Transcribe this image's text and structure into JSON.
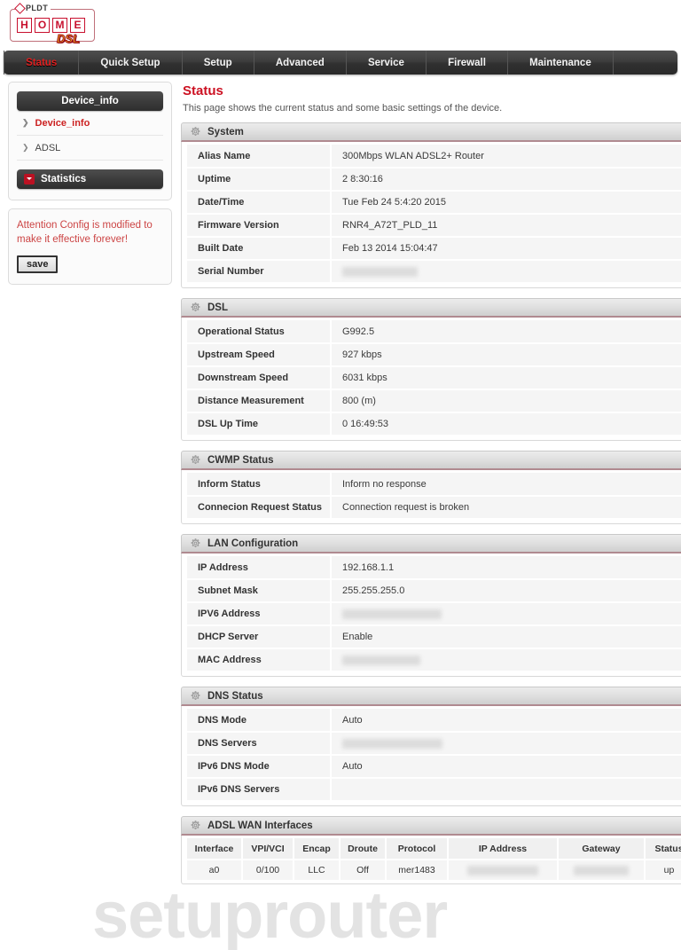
{
  "brand": {
    "pldt": "PLDT",
    "home_letters": [
      "H",
      "O",
      "M",
      "E"
    ],
    "dsl": "DSL"
  },
  "nav": {
    "items": [
      {
        "label": "Status",
        "active": true
      },
      {
        "label": "Quick Setup",
        "active": false
      },
      {
        "label": "Setup",
        "active": false
      },
      {
        "label": "Advanced",
        "active": false
      },
      {
        "label": "Service",
        "active": false
      },
      {
        "label": "Firewall",
        "active": false
      },
      {
        "label": "Maintenance",
        "active": false
      }
    ]
  },
  "sidebar": {
    "device_info_header": "Device_info",
    "links": [
      {
        "label": "Device_info",
        "active": true
      },
      {
        "label": "ADSL",
        "active": false
      }
    ],
    "statistics_header": "Statistics",
    "attention_text": "Attention Config is modified to make it effective forever!",
    "save_label": "save"
  },
  "main": {
    "title": "Status",
    "subtitle": "This page shows the current status and some basic settings of the device.",
    "sections": [
      {
        "name": "System",
        "rows": [
          {
            "key": "Alias Name",
            "value": "300Mbps WLAN ADSL2+ Router",
            "redacted": false
          },
          {
            "key": "Uptime",
            "value": "2 8:30:16",
            "redacted": false
          },
          {
            "key": "Date/Time",
            "value": "Tue Feb 24 5:4:20 2015",
            "redacted": false
          },
          {
            "key": "Firmware Version",
            "value": "RNR4_A72T_PLD_11",
            "redacted": false
          },
          {
            "key": "Built Date",
            "value": "Feb 13 2014 15:04:47",
            "redacted": false
          },
          {
            "key": "Serial Number",
            "value": "",
            "redacted": true,
            "redact_width": 85
          }
        ]
      },
      {
        "name": "DSL",
        "rows": [
          {
            "key": "Operational Status",
            "value": "G992.5",
            "redacted": false
          },
          {
            "key": "Upstream Speed",
            "value": "927 kbps",
            "redacted": false
          },
          {
            "key": "Downstream Speed",
            "value": "6031 kbps",
            "redacted": false
          },
          {
            "key": "Distance Measurement",
            "value": "800 (m)",
            "redacted": false
          },
          {
            "key": "DSL Up Time",
            "value": "0 16:49:53",
            "redacted": false
          }
        ]
      },
      {
        "name": "CWMP Status",
        "rows": [
          {
            "key": "Inform Status",
            "value": "Inform no response",
            "redacted": false
          },
          {
            "key": "Connecion Request Status",
            "value": "Connection request is broken",
            "redacted": false
          }
        ]
      },
      {
        "name": "LAN Configuration",
        "rows": [
          {
            "key": "IP Address",
            "value": "192.168.1.1",
            "redacted": false
          },
          {
            "key": "Subnet Mask",
            "value": "255.255.255.0",
            "redacted": false
          },
          {
            "key": "IPV6 Address",
            "value": "",
            "redacted": true,
            "redact_width": 112
          },
          {
            "key": "DHCP Server",
            "value": "Enable",
            "redacted": false
          },
          {
            "key": "MAC Address",
            "value": "",
            "redacted": true,
            "redact_width": 88
          }
        ]
      },
      {
        "name": "DNS Status",
        "rows": [
          {
            "key": "DNS Mode",
            "value": "Auto",
            "redacted": false
          },
          {
            "key": "DNS Servers",
            "value": "",
            "redacted": true,
            "redact_width": 113
          },
          {
            "key": "IPv6 DNS Mode",
            "value": "Auto",
            "redacted": false
          },
          {
            "key": "IPv6 DNS Servers",
            "value": "",
            "redacted": false
          }
        ]
      }
    ],
    "wan_section": {
      "name": "ADSL WAN Interfaces",
      "columns": [
        "Interface",
        "VPI/VCI",
        "Encap",
        "Droute",
        "Protocol",
        "IP Address",
        "Gateway",
        "Status"
      ],
      "rows": [
        {
          "cells": [
            {
              "value": "a0",
              "redacted": false
            },
            {
              "value": "0/100",
              "redacted": false
            },
            {
              "value": "LLC",
              "redacted": false
            },
            {
              "value": "Off",
              "redacted": false
            },
            {
              "value": "mer1483",
              "redacted": false
            },
            {
              "value": "",
              "redacted": true,
              "redact_width": 80
            },
            {
              "value": "",
              "redacted": true,
              "redact_width": 62
            },
            {
              "value": "up",
              "redacted": false
            }
          ]
        }
      ]
    }
  },
  "watermark": {
    "text": "setuprouter"
  },
  "colors": {
    "accent_red": "#cc1122",
    "nav_dark": "#3d3d3d",
    "row_bg": "#f5f5f5",
    "header_gray": "#dfdfdf"
  }
}
